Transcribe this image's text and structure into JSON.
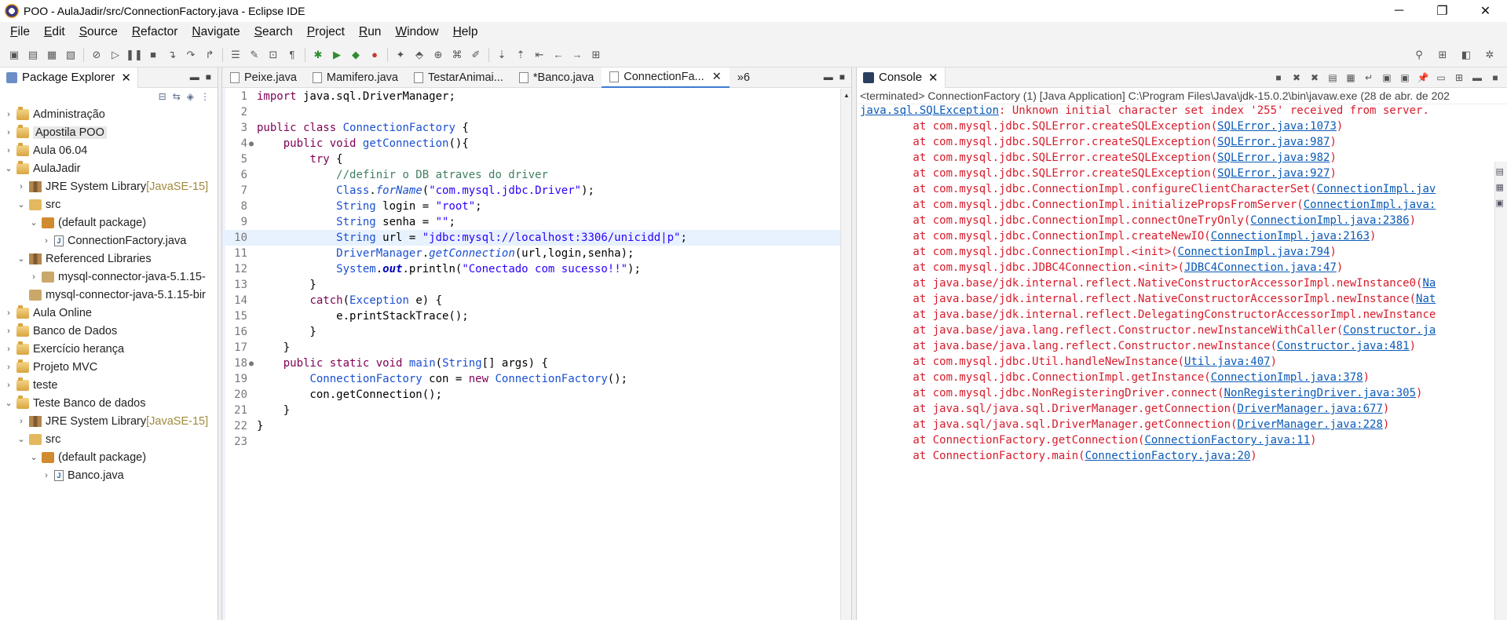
{
  "window": {
    "title": "POO - AulaJadir/src/ConnectionFactory.java - Eclipse IDE",
    "minimize": "─",
    "restore": "❐",
    "close": "✕"
  },
  "menu": [
    "File",
    "Edit",
    "Source",
    "Refactor",
    "Navigate",
    "Search",
    "Project",
    "Run",
    "Window",
    "Help"
  ],
  "package_explorer": {
    "tab_label": "Package Explorer",
    "tree": [
      {
        "label": "Administração",
        "kind": "proj",
        "depth": 0,
        "arrow": "›"
      },
      {
        "label": "Apostila POO",
        "kind": "proj",
        "depth": 0,
        "arrow": "›",
        "highlight": true
      },
      {
        "label": "Aula 06.04",
        "kind": "proj",
        "depth": 0,
        "arrow": "›"
      },
      {
        "label": "AulaJadir",
        "kind": "proj",
        "depth": 0,
        "arrow": "⌄"
      },
      {
        "label": "JRE System Library",
        "suffix": " [JavaSE-15]",
        "kind": "lib",
        "depth": 1,
        "arrow": "›"
      },
      {
        "label": "src",
        "kind": "src",
        "depth": 1,
        "arrow": "⌄"
      },
      {
        "label": "(default package)",
        "kind": "pkg",
        "depth": 2,
        "arrow": "⌄"
      },
      {
        "label": "ConnectionFactory.java",
        "kind": "java",
        "depth": 3,
        "arrow": "›"
      },
      {
        "label": "Referenced Libraries",
        "kind": "lib",
        "depth": 1,
        "arrow": "⌄"
      },
      {
        "label": "mysql-connector-java-5.1.15-",
        "kind": "jar",
        "depth": 2,
        "arrow": "›"
      },
      {
        "label": "mysql-connector-java-5.1.15-bir",
        "kind": "jar",
        "depth": 1,
        "arrow": ""
      },
      {
        "label": "Aula Online",
        "kind": "proj",
        "depth": 0,
        "arrow": "›"
      },
      {
        "label": "Banco de Dados",
        "kind": "proj",
        "depth": 0,
        "arrow": "›"
      },
      {
        "label": "Exercício herança",
        "kind": "proj",
        "depth": 0,
        "arrow": "›"
      },
      {
        "label": "Projeto MVC",
        "kind": "proj",
        "depth": 0,
        "arrow": "›"
      },
      {
        "label": "teste",
        "kind": "proj",
        "depth": 0,
        "arrow": "›"
      },
      {
        "label": "Teste Banco de dados",
        "kind": "proj",
        "depth": 0,
        "arrow": "⌄"
      },
      {
        "label": "JRE System Library",
        "suffix": " [JavaSE-15]",
        "kind": "lib",
        "depth": 1,
        "arrow": "›"
      },
      {
        "label": "src",
        "kind": "src",
        "depth": 1,
        "arrow": "⌄"
      },
      {
        "label": "(default package)",
        "kind": "pkg",
        "depth": 2,
        "arrow": "⌄"
      },
      {
        "label": "Banco.java",
        "kind": "java",
        "depth": 3,
        "arrow": "›"
      }
    ]
  },
  "editor": {
    "tabs": [
      {
        "label": "Peixe.java",
        "active": false
      },
      {
        "label": "Mamifero.java",
        "active": false
      },
      {
        "label": "TestarAnimai...",
        "active": false
      },
      {
        "label": "*Banco.java",
        "active": false
      },
      {
        "label": "ConnectionFa...",
        "active": true
      }
    ],
    "overflow": "»6",
    "current_line": 10,
    "lines": [
      {
        "n": "1",
        "html": "<span class='kw'>import</span> java.sql.DriverManager;"
      },
      {
        "n": "2",
        "html": ""
      },
      {
        "n": "3",
        "html": "<span class='kw'>public</span> <span class='kw'>class</span> <span class='ty'>ConnectionFactory</span> {"
      },
      {
        "n": "4",
        "mark": "●",
        "html": "    <span class='kw'>public</span> <span class='kw'>void</span> <span class='ty'>getConnection</span>(){"
      },
      {
        "n": "5",
        "html": "        <span class='kw'>try</span> {"
      },
      {
        "n": "6",
        "html": "            <span class='cm'>//definir o DB atraves do driver</span>"
      },
      {
        "n": "7",
        "html": "            <span class='ty'>Class</span>.<span class='it ty'>forName</span>(<span class='st'>\"com.mysql.jdbc.Driver\"</span>);"
      },
      {
        "n": "8",
        "html": "            <span class='ty'>String</span> login = <span class='st'>\"root\"</span>;"
      },
      {
        "n": "9",
        "html": "            <span class='ty'>String</span> senha = <span class='st'>\"\"</span>;"
      },
      {
        "n": "10",
        "html": "            <span class='ty'>String</span> url = <span class='st'>\"jdbc:mysql://localhost:3306/unicidd|p\"</span>;"
      },
      {
        "n": "11",
        "html": "            <span class='ty'>DriverManager</span>.<span class='it ty'>getConnection</span>(url,login,senha);"
      },
      {
        "n": "12",
        "html": "            <span class='ty'>System</span>.<span class='fd'>out</span>.println(<span class='st'>\"Conectado com sucesso!!\"</span>);"
      },
      {
        "n": "13",
        "html": "        }"
      },
      {
        "n": "14",
        "html": "        <span class='kw'>catch</span>(<span class='ty'>Exception</span> e) {"
      },
      {
        "n": "15",
        "html": "            e.printStackTrace();"
      },
      {
        "n": "16",
        "html": "        }"
      },
      {
        "n": "17",
        "html": "    }"
      },
      {
        "n": "18",
        "mark": "●",
        "html": "    <span class='kw'>public</span> <span class='kw'>static</span> <span class='kw'>void</span> <span class='ty'>main</span>(<span class='ty'>String</span>[] args) {"
      },
      {
        "n": "19",
        "html": "        <span class='ty'>ConnectionFactory</span> con = <span class='kw'>new</span> <span class='ty'>ConnectionFactory</span>();"
      },
      {
        "n": "20",
        "html": "        con.getConnection();"
      },
      {
        "n": "21",
        "html": "    }"
      },
      {
        "n": "22",
        "html": "}"
      },
      {
        "n": "23",
        "html": ""
      }
    ]
  },
  "console": {
    "tab_label": "Console",
    "terminated": "<terminated> ConnectionFactory (1) [Java Application] C:\\Program Files\\Java\\jdk-15.0.2\\bin\\javaw.exe  (28 de abr. de 202",
    "lines": [
      {
        "pre": "",
        "link": "java.sql.SQLException",
        "post": ": Unknown initial character set index '255' received from server."
      },
      {
        "pre": "\tat com.mysql.jdbc.SQLError.createSQLException(",
        "link": "SQLError.java:1073",
        "post": ")"
      },
      {
        "pre": "\tat com.mysql.jdbc.SQLError.createSQLException(",
        "link": "SQLError.java:987",
        "post": ")"
      },
      {
        "pre": "\tat com.mysql.jdbc.SQLError.createSQLException(",
        "link": "SQLError.java:982",
        "post": ")"
      },
      {
        "pre": "\tat com.mysql.jdbc.SQLError.createSQLException(",
        "link": "SQLError.java:927",
        "post": ")"
      },
      {
        "pre": "\tat com.mysql.jdbc.ConnectionImpl.configureClientCharacterSet(",
        "link": "ConnectionImpl.jav",
        "post": ""
      },
      {
        "pre": "\tat com.mysql.jdbc.ConnectionImpl.initializePropsFromServer(",
        "link": "ConnectionImpl.java:",
        "post": ""
      },
      {
        "pre": "\tat com.mysql.jdbc.ConnectionImpl.connectOneTryOnly(",
        "link": "ConnectionImpl.java:2386",
        "post": ")"
      },
      {
        "pre": "\tat com.mysql.jdbc.ConnectionImpl.createNewIO(",
        "link": "ConnectionImpl.java:2163",
        "post": ")"
      },
      {
        "pre": "\tat com.mysql.jdbc.ConnectionImpl.<init>(",
        "link": "ConnectionImpl.java:794",
        "post": ")"
      },
      {
        "pre": "\tat com.mysql.jdbc.JDBC4Connection.<init>(",
        "link": "JDBC4Connection.java:47",
        "post": ")"
      },
      {
        "pre": "\tat java.base/jdk.internal.reflect.NativeConstructorAccessorImpl.newInstance0(",
        "link": "Na",
        "post": ""
      },
      {
        "pre": "\tat java.base/jdk.internal.reflect.NativeConstructorAccessorImpl.newInstance(",
        "link": "Nat",
        "post": ""
      },
      {
        "pre": "\tat java.base/jdk.internal.reflect.DelegatingConstructorAccessorImpl.newInstance",
        "link": "",
        "post": ""
      },
      {
        "pre": "\tat java.base/java.lang.reflect.Constructor.newInstanceWithCaller(",
        "link": "Constructor.ja",
        "post": ""
      },
      {
        "pre": "\tat java.base/java.lang.reflect.Constructor.newInstance(",
        "link": "Constructor.java:481",
        "post": ")"
      },
      {
        "pre": "\tat com.mysql.jdbc.Util.handleNewInstance(",
        "link": "Util.java:407",
        "post": ")"
      },
      {
        "pre": "\tat com.mysql.jdbc.ConnectionImpl.getInstance(",
        "link": "ConnectionImpl.java:378",
        "post": ")"
      },
      {
        "pre": "\tat com.mysql.jdbc.NonRegisteringDriver.connect(",
        "link": "NonRegisteringDriver.java:305",
        "post": ")"
      },
      {
        "pre": "\tat java.sql/java.sql.DriverManager.getConnection(",
        "link": "DriverManager.java:677",
        "post": ")"
      },
      {
        "pre": "\tat java.sql/java.sql.DriverManager.getConnection(",
        "link": "DriverManager.java:228",
        "post": ")"
      },
      {
        "pre": "\tat ConnectionFactory.getConnection(",
        "link": "ConnectionFactory.java:11",
        "post": ")"
      },
      {
        "pre": "\tat ConnectionFactory.main(",
        "link": "ConnectionFactory.java:20",
        "post": ")"
      }
    ]
  },
  "colors": {
    "error": "#d71b2b",
    "link": "#0b5ab8",
    "accent": "#3d7dd0"
  }
}
